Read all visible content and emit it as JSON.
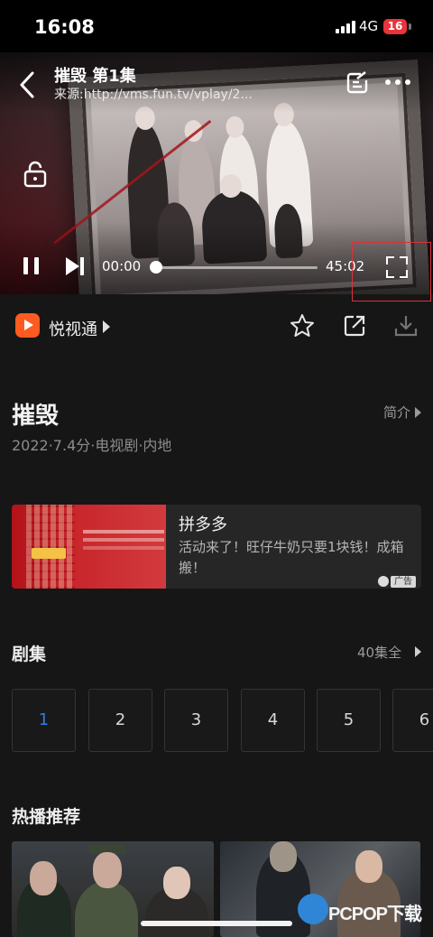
{
  "status_bar": {
    "time": "16:08",
    "network": "4G",
    "battery": "16"
  },
  "player": {
    "title": "摧毁 第1集",
    "source": "来源:http://vms.fun.tv/vplay/2...",
    "current_time": "00:00",
    "total_time": "45:02",
    "progress": 0,
    "icons": [
      "back-icon",
      "note-icon",
      "more-icon",
      "lock-icon",
      "pause-icon",
      "next-icon",
      "fullscreen-icon"
    ]
  },
  "source_row": {
    "app_name": "悦视通",
    "actions": [
      "star-icon",
      "share-icon",
      "download-icon"
    ]
  },
  "show": {
    "title": "摧毁",
    "intro_label": "简介",
    "meta": "2022·7.4分·电视剧·内地"
  },
  "ad": {
    "title": "拼多多",
    "description": "活动来了！旺仔牛奶只要1块钱！成箱搬！",
    "tag": "广告"
  },
  "episodes": {
    "heading": "剧集",
    "count_label": "40集全",
    "items": [
      "1",
      "2",
      "3",
      "4",
      "5",
      "6"
    ],
    "active": "1"
  },
  "hot": {
    "heading": "热播推荐"
  },
  "watermark": {
    "text": "PCPOP下载"
  },
  "colors": {
    "accent": "#2f7ee6",
    "app_icon": "#ff5a1f",
    "highlight": "#d9323a",
    "battery": "#e8343a"
  }
}
